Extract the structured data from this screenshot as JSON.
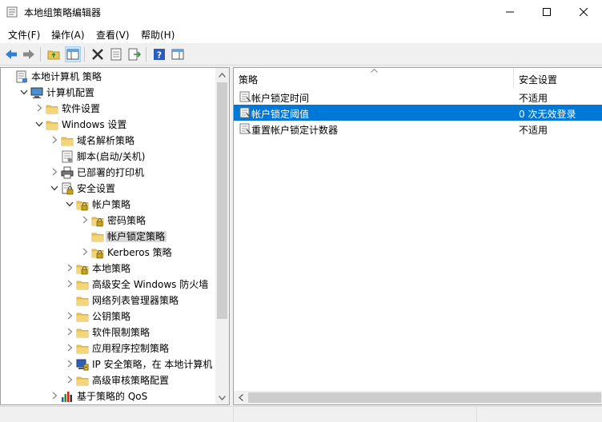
{
  "window": {
    "title": "本地组策略编辑器"
  },
  "menu": {
    "items": [
      "文件(F)",
      "操作(A)",
      "查看(V)",
      "帮助(H)"
    ]
  },
  "toolbar": {
    "buttons": [
      "back-icon",
      "forward-icon",
      "up-folder-icon",
      "show-hide-tree-icon",
      "delete-icon",
      "properties-icon",
      "export-list-icon",
      "help-icon",
      "show-hide-action-pane-icon"
    ]
  },
  "tree": {
    "items": [
      {
        "label": "本地计算机 策略",
        "level": 0,
        "twisty": "none",
        "icon": "policy"
      },
      {
        "label": "计算机配置",
        "level": 1,
        "twisty": "open",
        "icon": "computer"
      },
      {
        "label": "软件设置",
        "level": 2,
        "twisty": "closed",
        "icon": "folder"
      },
      {
        "label": "Windows 设置",
        "level": 2,
        "twisty": "open",
        "icon": "folder"
      },
      {
        "label": "域名解析策略",
        "level": 3,
        "twisty": "closed",
        "icon": "folder"
      },
      {
        "label": "脚本(启动/关机)",
        "level": 3,
        "twisty": "none",
        "icon": "script"
      },
      {
        "label": "已部署的打印机",
        "level": 3,
        "twisty": "closed",
        "icon": "printer"
      },
      {
        "label": "安全设置",
        "level": 3,
        "twisty": "open",
        "icon": "security"
      },
      {
        "label": "帐户策略",
        "level": 4,
        "twisty": "open",
        "icon": "lockfolder"
      },
      {
        "label": "密码策略",
        "level": 5,
        "twisty": "closed",
        "icon": "lockfolder"
      },
      {
        "label": "帐户锁定策略",
        "level": 5,
        "twisty": "none",
        "icon": "folder",
        "selected": true
      },
      {
        "label": "Kerberos 策略",
        "level": 5,
        "twisty": "closed",
        "icon": "lockfolder"
      },
      {
        "label": "本地策略",
        "level": 4,
        "twisty": "closed",
        "icon": "lockfolder"
      },
      {
        "label": "高级安全 Windows 防火墙",
        "level": 4,
        "twisty": "closed",
        "icon": "folder"
      },
      {
        "label": "网络列表管理器策略",
        "level": 4,
        "twisty": "none",
        "icon": "folder"
      },
      {
        "label": "公钥策略",
        "level": 4,
        "twisty": "closed",
        "icon": "folder"
      },
      {
        "label": "软件限制策略",
        "level": 4,
        "twisty": "closed",
        "icon": "folder"
      },
      {
        "label": "应用程序控制策略",
        "level": 4,
        "twisty": "closed",
        "icon": "folder"
      },
      {
        "label": "IP 安全策略，在 本地计算机",
        "level": 4,
        "twisty": "closed",
        "icon": "ipsec"
      },
      {
        "label": "高级审核策略配置",
        "level": 4,
        "twisty": "closed",
        "icon": "folder"
      },
      {
        "label": "基于策略的 QoS",
        "level": 3,
        "twisty": "closed",
        "icon": "chart"
      }
    ]
  },
  "list": {
    "headers": [
      "策略",
      "安全设置"
    ],
    "rows": [
      {
        "policy": "帐户锁定时间",
        "setting": "不适用",
        "selected": false
      },
      {
        "policy": "帐户锁定阈值",
        "setting": "0 次无效登录",
        "selected": true
      },
      {
        "policy": "重置帐户锁定计数器",
        "setting": "不适用",
        "selected": false
      }
    ]
  },
  "colors": {
    "selection": "#0078d7",
    "tree_selection": "#d9d9d9",
    "folder": "#e8c65a"
  }
}
